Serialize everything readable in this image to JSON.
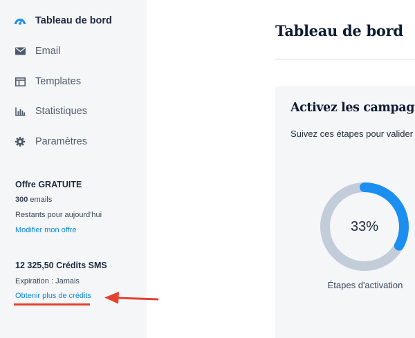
{
  "sidebar": {
    "items": [
      {
        "label": "Tableau de bord",
        "icon": "dashboard-icon",
        "active": true
      },
      {
        "label": "Email",
        "icon": "envelope-icon",
        "active": false
      },
      {
        "label": "Templates",
        "icon": "template-icon",
        "active": false
      },
      {
        "label": "Statistiques",
        "icon": "bar-chart-icon",
        "active": false
      },
      {
        "label": "Paramètres",
        "icon": "gear-icon",
        "active": false
      }
    ],
    "plan": {
      "title": "Offre GRATUITE",
      "emails_count": "300",
      "emails_unit": " emails",
      "remaining": "Restants pour aujourd'hui",
      "modify_link": "Modifier mon offre"
    },
    "sms": {
      "credits": "12 325,50 Crédits SMS",
      "expiration": "Expiration : Jamais",
      "more_link": "Obtenir plus de crédits"
    }
  },
  "main": {
    "title": "Tableau de bord",
    "card": {
      "title": "Activez les campagnes",
      "subtitle": "Suivez ces étapes pour valider",
      "progress_percent": 33,
      "progress_text": "33%",
      "progress_label": "Étapes d'activation"
    }
  },
  "colors": {
    "accent": "#0b86d8",
    "donut_fill": "#1a8ff0",
    "donut_track": "#c3ccd9",
    "annotation": "#e5412f",
    "sidebar_bg": "#f5f6f8"
  }
}
